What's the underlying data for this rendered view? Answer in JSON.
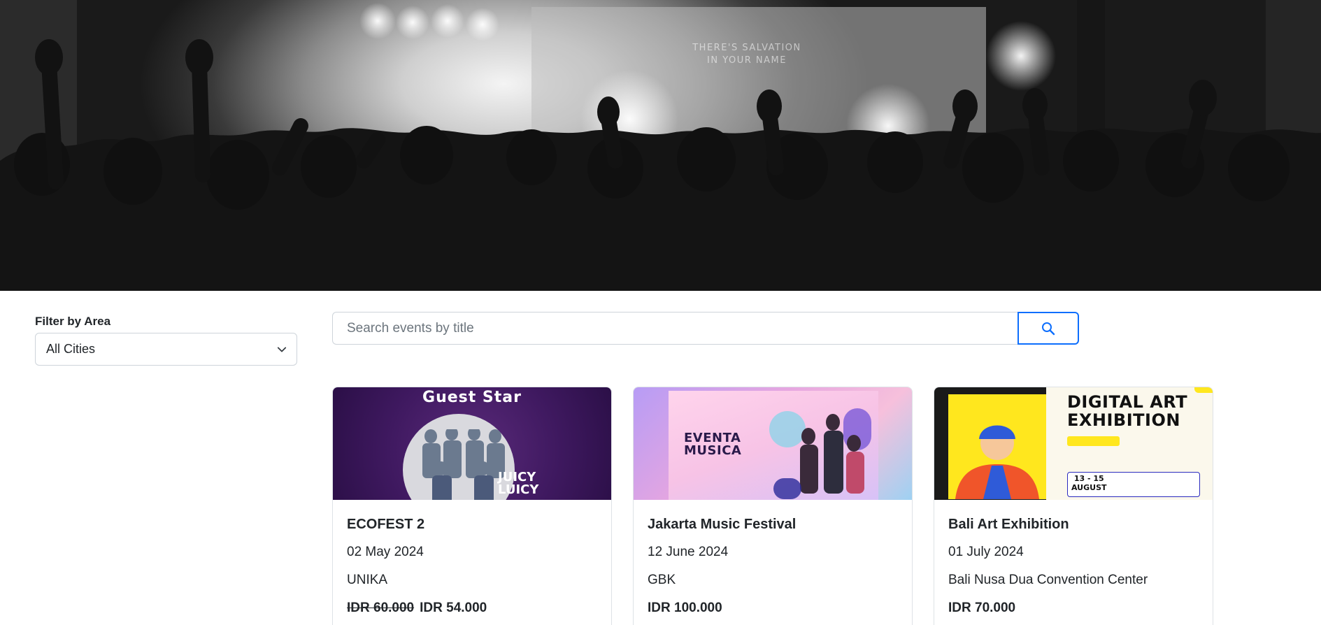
{
  "hero": {
    "screen_text_line1": "THERE'S SALVATION",
    "screen_text_line2": "IN YOUR NAME"
  },
  "filter": {
    "label": "Filter by Area",
    "selected": "All Cities",
    "icon": "chevron-down-icon"
  },
  "search": {
    "placeholder": "Search events by title",
    "value": "",
    "icon": "search-icon",
    "accent_color": "#0d6efd"
  },
  "events": [
    {
      "title": "ECOFEST 2",
      "date": "02 May 2024",
      "venue": "UNIKA",
      "price_original": "IDR 60.000",
      "price": "IDR 54.000",
      "poster": {
        "heading": "Guest Star",
        "caption_line1": "JUICY",
        "caption_line2": "LUICY"
      }
    },
    {
      "title": "Jakarta Music Festival",
      "date": "12 June 2024",
      "venue": "GBK",
      "price": "IDR 100.000",
      "poster": {
        "heading_line1": "EVENTA",
        "heading_line2": "MUSICA"
      }
    },
    {
      "title": "Bali Art Exhibition",
      "date": "01 July 2024",
      "venue": "Bali Nusa Dua Convention Center",
      "price": "IDR 70.000",
      "poster": {
        "heading_line1": "DIGITAL ART",
        "heading_line2": "EXHIBITION",
        "dates_line1": "13 - 15",
        "dates_line2": "AUGUST"
      }
    }
  ]
}
